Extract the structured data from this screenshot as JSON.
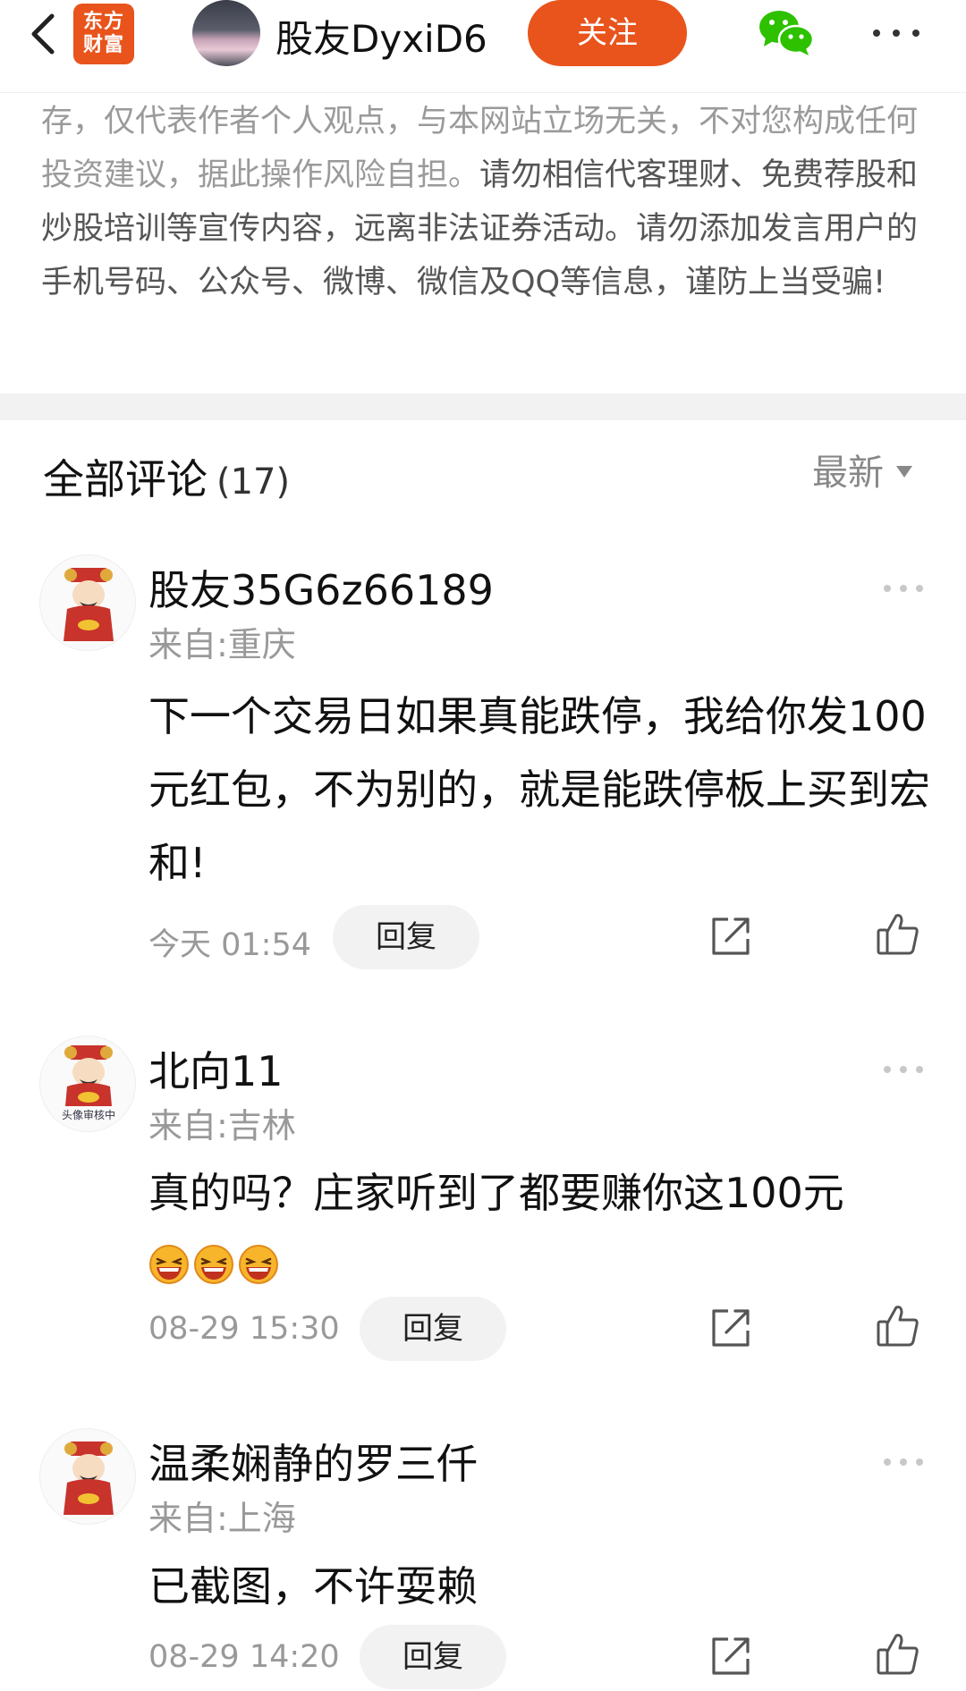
{
  "header": {
    "logo_line1": "东方",
    "logo_line2": "财富",
    "author_name": "股友DyxiD6",
    "follow_label": "关注"
  },
  "disclaimer": {
    "normal": "存，仅代表作者个人观点，与本网站立场无关，不对您构成任何投资建议，据此操作风险自担。",
    "emphasis": "请勿相信代客理财、免费荐股和炒股培训等宣传内容，远离非法证券活动。请勿添加发言用户的手机号码、公众号、微博、微信及QQ等信息，谨防上当受骗!"
  },
  "comments_section": {
    "title": "全部评论",
    "count": "(17)",
    "sort_label": "最新"
  },
  "comments": [
    {
      "name": "股友35G6z66189",
      "from": "来自:重庆",
      "text": "下一个交易日如果真能跌停，我给你发100元红包，不为别的，就是能跌停板上买到宏和!",
      "time": "今天 01:54",
      "reply_label": "回复"
    },
    {
      "name": "北向11",
      "from": "来自:吉林",
      "text": "真的吗？庄家听到了都要赚你这100元",
      "emojis": [
        "laughing-emoji",
        "laughing-emoji",
        "laughing-emoji"
      ],
      "avatar_caption": "头像审核中",
      "time": "08-29 15:30",
      "reply_label": "回复"
    },
    {
      "name": "温柔娴静的罗三仟",
      "from": "来自:上海",
      "text": "已截图，不许耍赖",
      "time": "08-29 14:20",
      "reply_label": "回复"
    }
  ],
  "colors": {
    "brand": "#e8541c",
    "wechat": "#2dc100",
    "muted_text": "#999999"
  }
}
